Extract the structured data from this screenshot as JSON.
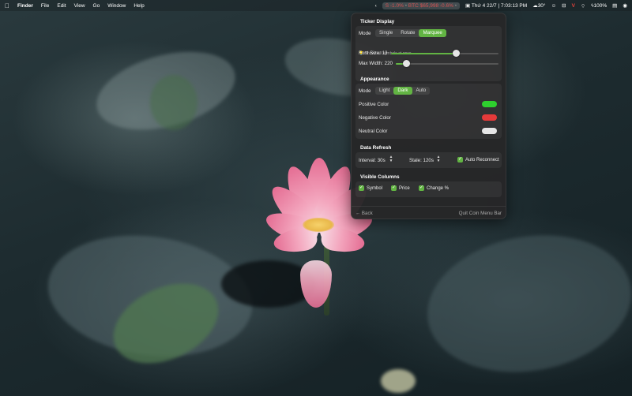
{
  "menubar": {
    "apple_icon": "apple-icon",
    "app_name": "Finder",
    "menus": [
      "File",
      "Edit",
      "View",
      "Go",
      "Window",
      "Help"
    ],
    "ticker_1": "S -1.0%",
    "ticker_2": "BTC $65,998 -0.6%",
    "datetime": "Thứ 4 22/7 | 7:03:13 PM",
    "weather": "30°",
    "battery": "100%",
    "ticker_color": "#e05555"
  },
  "popover": {
    "ticker_display": {
      "title": "Ticker Display",
      "mode_label": "Mode",
      "modes": [
        "Single",
        "Rotate",
        "Marquee"
      ],
      "active_mode": "Marquee",
      "hint": "Shows all symbols at once",
      "font_size_label": "Font Size: 13",
      "font_size_value": 13,
      "font_size_fraction": 0.6,
      "max_width_label": "Max Width: 220",
      "max_width_value": 220,
      "max_width_fraction": 0.1
    },
    "appearance": {
      "title": "Appearance",
      "mode_label": "Mode",
      "modes": [
        "Light",
        "Dark",
        "Auto"
      ],
      "active_mode": "Dark",
      "positive_label": "Positive Color",
      "negative_label": "Negative Color",
      "neutral_label": "Neutral Color",
      "positive_color": "#2ed02e",
      "negative_color": "#e63a3a",
      "neutral_color": "#e6e6e6"
    },
    "data_refresh": {
      "title": "Data Refresh",
      "interval_label": "Interval: 30s",
      "stale_label": "Stale: 120s",
      "auto_reconnect_label": "Auto Reconnect",
      "auto_reconnect": true
    },
    "visible_columns": {
      "title": "Visible Columns",
      "symbol_label": "Symbol",
      "price_label": "Price",
      "change_label": "Change %"
    },
    "footer": {
      "back_label": "← Back",
      "quit_label": "Quit Coin Menu Bar"
    },
    "accent_color": "#62b443"
  }
}
